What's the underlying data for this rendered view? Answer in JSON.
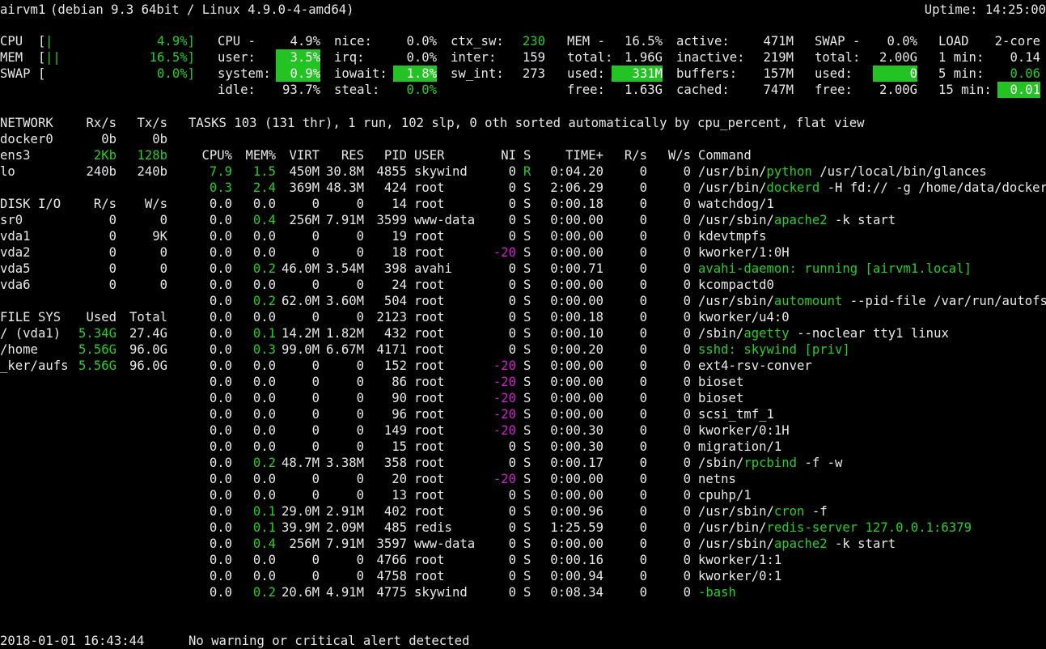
{
  "header": {
    "host": "airvm1",
    "os": "(debian 9.3 64bit / Linux 4.9.0-4-amd64)",
    "uptime": "Uptime: 14:25:00"
  },
  "quicklook": {
    "cpu_label": "CPU  [",
    "cpu_bar": "|",
    "cpu_value": "4.9%]",
    "mem_label": "MEM  [",
    "mem_bar": "||",
    "mem_value": "16.5%]",
    "swap_label": "SWAP [",
    "swap_value": "0.0%]"
  },
  "cpu": {
    "title": "CPU -",
    "total": "4.9%",
    "rows": [
      {
        "k": "user:",
        "v": "3.5%",
        "hl": true
      },
      {
        "k": "system:",
        "v": "0.9%",
        "hl": true
      },
      {
        "k": "idle:",
        "v": "93.7%",
        "hl": false
      }
    ],
    "col2": [
      {
        "k": "nice:",
        "v": "0.0%",
        "hl": false,
        "g": false
      },
      {
        "k": "irq:",
        "v": "0.0%",
        "hl": false,
        "g": false
      },
      {
        "k": "iowait:",
        "v": "1.8%",
        "hl": true,
        "g": false
      },
      {
        "k": "steal:",
        "v": "0.0%",
        "hl": false,
        "g": true
      }
    ],
    "col3": [
      {
        "k": "ctx_sw:",
        "v": "230",
        "g": true
      },
      {
        "k": "inter:",
        "v": "159",
        "g": false
      },
      {
        "k": "sw_int:",
        "v": "273",
        "g": false
      }
    ]
  },
  "mem": {
    "title": "MEM -",
    "total_pct": "16.5%",
    "rows": [
      {
        "k": "total:",
        "v": "1.96G",
        "hl": false
      },
      {
        "k": "used:",
        "v": "331M",
        "hl": true
      },
      {
        "k": "free:",
        "v": "1.63G",
        "hl": false
      }
    ],
    "col2": [
      {
        "k": "active:",
        "v": "471M"
      },
      {
        "k": "inactive:",
        "v": "219M"
      },
      {
        "k": "buffers:",
        "v": "157M"
      },
      {
        "k": "cached:",
        "v": "747M"
      }
    ]
  },
  "swap": {
    "title": "SWAP -",
    "total_pct": "0.0%",
    "rows": [
      {
        "k": "total:",
        "v": "2.00G",
        "hl": false
      },
      {
        "k": "used:",
        "v": "0",
        "hl": true
      },
      {
        "k": "free:",
        "v": "2.00G",
        "hl": false
      }
    ]
  },
  "load": {
    "title": "LOAD",
    "cores": "2-core",
    "rows": [
      {
        "k": "1 min:",
        "v": "0.14",
        "g": false,
        "hl": false
      },
      {
        "k": "5 min:",
        "v": "0.06",
        "g": true,
        "hl": false
      },
      {
        "k": "15 min:",
        "v": "0.01",
        "g": false,
        "hl": true
      }
    ]
  },
  "network": {
    "title": "NETWORK",
    "rx": "Rx/s",
    "tx": "Tx/s",
    "rows": [
      {
        "name": "docker0",
        "rx": "0b",
        "tx": "0b",
        "g": false
      },
      {
        "name": "ens3",
        "rx": "2Kb",
        "tx": "128b",
        "g": true
      },
      {
        "name": "lo",
        "rx": "240b",
        "tx": "240b",
        "g": false
      }
    ]
  },
  "diskio": {
    "title": "DISK I/O",
    "r": "R/s",
    "w": "W/s",
    "rows": [
      {
        "name": "sr0",
        "r": "0",
        "w": "0"
      },
      {
        "name": "vda1",
        "r": "0",
        "w": "9K"
      },
      {
        "name": "vda2",
        "r": "0",
        "w": "0"
      },
      {
        "name": "vda5",
        "r": "0",
        "w": "0"
      },
      {
        "name": "vda6",
        "r": "0",
        "w": "0"
      }
    ]
  },
  "fs": {
    "title": "FILE SYS",
    "used": "Used",
    "total": "Total",
    "rows": [
      {
        "name": "/ (vda1)",
        "used": "5.34G",
        "total": "27.4G"
      },
      {
        "name": "/home",
        "used": "5.56G",
        "total": "96.0G"
      },
      {
        "name": "_ker/aufs",
        "used": "5.56G",
        "total": "96.0G"
      }
    ]
  },
  "tasks": {
    "summary": "TASKS 103 (131 thr), 1 run, 102 slp, 0 oth sorted automatically by cpu_percent, flat view",
    "headers": [
      "CPU%",
      "MEM%",
      "VIRT",
      "RES",
      "PID",
      "USER",
      "NI",
      "S",
      "TIME+",
      "R/s",
      "W/s",
      "Command"
    ],
    "rows": [
      {
        "cpu": "7.9",
        "mem": "1.5",
        "virt": "450M",
        "res": "30.8M",
        "pid": "4855",
        "user": "skywind",
        "ni": "0",
        "s": "R",
        "time": "0:04.20",
        "r": "0",
        "w": "0",
        "cmd_pre": "/usr/bin/",
        "cmd_hl": "python",
        "cmd_post": " /usr/local/bin/glances",
        "cpu_g": true,
        "mem_g": true,
        "s_g": true,
        "ni_m": false,
        "cmd_all_g": false
      },
      {
        "cpu": "0.3",
        "mem": "2.4",
        "virt": "369M",
        "res": "48.3M",
        "pid": "424",
        "user": "root",
        "ni": "0",
        "s": "S",
        "time": "2:06.29",
        "r": "0",
        "w": "0",
        "cmd_pre": "/usr/bin/",
        "cmd_hl": "dockerd",
        "cmd_post": " -H fd:// -g /home/data/docker",
        "cpu_g": true,
        "mem_g": true,
        "s_g": false,
        "ni_m": false,
        "cmd_all_g": false
      },
      {
        "cpu": "0.0",
        "mem": "0.0",
        "virt": "0",
        "res": "0",
        "pid": "14",
        "user": "root",
        "ni": "0",
        "s": "S",
        "time": "0:00.18",
        "r": "0",
        "w": "0",
        "cmd_pre": "watchdog/1",
        "cmd_hl": "",
        "cmd_post": "",
        "cpu_g": false,
        "mem_g": false,
        "s_g": false,
        "ni_m": false,
        "cmd_all_g": false
      },
      {
        "cpu": "0.0",
        "mem": "0.4",
        "virt": "256M",
        "res": "7.91M",
        "pid": "3599",
        "user": "www-data",
        "ni": "0",
        "s": "S",
        "time": "0:00.00",
        "r": "0",
        "w": "0",
        "cmd_pre": "/usr/sbin/",
        "cmd_hl": "apache2",
        "cmd_post": " -k start",
        "cpu_g": false,
        "mem_g": true,
        "s_g": false,
        "ni_m": false,
        "cmd_all_g": false
      },
      {
        "cpu": "0.0",
        "mem": "0.0",
        "virt": "0",
        "res": "0",
        "pid": "19",
        "user": "root",
        "ni": "0",
        "s": "S",
        "time": "0:00.00",
        "r": "0",
        "w": "0",
        "cmd_pre": "kdevtmpfs",
        "cmd_hl": "",
        "cmd_post": "",
        "cpu_g": false,
        "mem_g": false,
        "s_g": false,
        "ni_m": false,
        "cmd_all_g": false
      },
      {
        "cpu": "0.0",
        "mem": "0.0",
        "virt": "0",
        "res": "0",
        "pid": "18",
        "user": "root",
        "ni": "-20",
        "s": "S",
        "time": "0:00.00",
        "r": "0",
        "w": "0",
        "cmd_pre": "kworker/1:0H",
        "cmd_hl": "",
        "cmd_post": "",
        "cpu_g": false,
        "mem_g": false,
        "s_g": false,
        "ni_m": true,
        "cmd_all_g": false
      },
      {
        "cpu": "0.0",
        "mem": "0.2",
        "virt": "46.0M",
        "res": "3.54M",
        "pid": "398",
        "user": "avahi",
        "ni": "0",
        "s": "S",
        "time": "0:00.71",
        "r": "0",
        "w": "0",
        "cmd_pre": "avahi-daemon: running [airvm1.local]",
        "cmd_hl": "",
        "cmd_post": "",
        "cpu_g": false,
        "mem_g": true,
        "s_g": false,
        "ni_m": false,
        "cmd_all_g": true
      },
      {
        "cpu": "0.0",
        "mem": "0.0",
        "virt": "0",
        "res": "0",
        "pid": "24",
        "user": "root",
        "ni": "0",
        "s": "S",
        "time": "0:00.00",
        "r": "0",
        "w": "0",
        "cmd_pre": "kcompactd0",
        "cmd_hl": "",
        "cmd_post": "",
        "cpu_g": false,
        "mem_g": false,
        "s_g": false,
        "ni_m": false,
        "cmd_all_g": false
      },
      {
        "cpu": "0.0",
        "mem": "0.2",
        "virt": "62.0M",
        "res": "3.60M",
        "pid": "504",
        "user": "root",
        "ni": "0",
        "s": "S",
        "time": "0:00.00",
        "r": "0",
        "w": "0",
        "cmd_pre": "/usr/sbin/",
        "cmd_hl": "automount",
        "cmd_post": " --pid-file /var/run/autofs.p",
        "cpu_g": false,
        "mem_g": true,
        "s_g": false,
        "ni_m": false,
        "cmd_all_g": false
      },
      {
        "cpu": "0.0",
        "mem": "0.0",
        "virt": "0",
        "res": "0",
        "pid": "2123",
        "user": "root",
        "ni": "0",
        "s": "S",
        "time": "0:00.18",
        "r": "0",
        "w": "0",
        "cmd_pre": "kworker/u4:0",
        "cmd_hl": "",
        "cmd_post": "",
        "cpu_g": false,
        "mem_g": false,
        "s_g": false,
        "ni_m": false,
        "cmd_all_g": false
      },
      {
        "cpu": "0.0",
        "mem": "0.1",
        "virt": "14.2M",
        "res": "1.82M",
        "pid": "432",
        "user": "root",
        "ni": "0",
        "s": "S",
        "time": "0:00.10",
        "r": "0",
        "w": "0",
        "cmd_pre": "/sbin/",
        "cmd_hl": "agetty",
        "cmd_post": " --noclear tty1 linux",
        "cpu_g": false,
        "mem_g": true,
        "s_g": false,
        "ni_m": false,
        "cmd_all_g": false
      },
      {
        "cpu": "0.0",
        "mem": "0.3",
        "virt": "99.0M",
        "res": "6.67M",
        "pid": "4171",
        "user": "root",
        "ni": "0",
        "s": "S",
        "time": "0:00.20",
        "r": "0",
        "w": "0",
        "cmd_pre": "sshd: skywind [priv]",
        "cmd_hl": "",
        "cmd_post": "",
        "cpu_g": false,
        "mem_g": true,
        "s_g": false,
        "ni_m": false,
        "cmd_all_g": true
      },
      {
        "cpu": "0.0",
        "mem": "0.0",
        "virt": "0",
        "res": "0",
        "pid": "152",
        "user": "root",
        "ni": "-20",
        "s": "S",
        "time": "0:00.00",
        "r": "0",
        "w": "0",
        "cmd_pre": "ext4-rsv-conver",
        "cmd_hl": "",
        "cmd_post": "",
        "cpu_g": false,
        "mem_g": false,
        "s_g": false,
        "ni_m": true,
        "cmd_all_g": false
      },
      {
        "cpu": "0.0",
        "mem": "0.0",
        "virt": "0",
        "res": "0",
        "pid": "86",
        "user": "root",
        "ni": "-20",
        "s": "S",
        "time": "0:00.00",
        "r": "0",
        "w": "0",
        "cmd_pre": "bioset",
        "cmd_hl": "",
        "cmd_post": "",
        "cpu_g": false,
        "mem_g": false,
        "s_g": false,
        "ni_m": true,
        "cmd_all_g": false
      },
      {
        "cpu": "0.0",
        "mem": "0.0",
        "virt": "0",
        "res": "0",
        "pid": "90",
        "user": "root",
        "ni": "-20",
        "s": "S",
        "time": "0:00.00",
        "r": "0",
        "w": "0",
        "cmd_pre": "bioset",
        "cmd_hl": "",
        "cmd_post": "",
        "cpu_g": false,
        "mem_g": false,
        "s_g": false,
        "ni_m": true,
        "cmd_all_g": false
      },
      {
        "cpu": "0.0",
        "mem": "0.0",
        "virt": "0",
        "res": "0",
        "pid": "96",
        "user": "root",
        "ni": "-20",
        "s": "S",
        "time": "0:00.00",
        "r": "0",
        "w": "0",
        "cmd_pre": "scsi_tmf_1",
        "cmd_hl": "",
        "cmd_post": "",
        "cpu_g": false,
        "mem_g": false,
        "s_g": false,
        "ni_m": true,
        "cmd_all_g": false
      },
      {
        "cpu": "0.0",
        "mem": "0.0",
        "virt": "0",
        "res": "0",
        "pid": "149",
        "user": "root",
        "ni": "-20",
        "s": "S",
        "time": "0:00.30",
        "r": "0",
        "w": "0",
        "cmd_pre": "kworker/0:1H",
        "cmd_hl": "",
        "cmd_post": "",
        "cpu_g": false,
        "mem_g": false,
        "s_g": false,
        "ni_m": true,
        "cmd_all_g": false
      },
      {
        "cpu": "0.0",
        "mem": "0.0",
        "virt": "0",
        "res": "0",
        "pid": "15",
        "user": "root",
        "ni": "0",
        "s": "S",
        "time": "0:00.30",
        "r": "0",
        "w": "0",
        "cmd_pre": "migration/1",
        "cmd_hl": "",
        "cmd_post": "",
        "cpu_g": false,
        "mem_g": false,
        "s_g": false,
        "ni_m": false,
        "cmd_all_g": false
      },
      {
        "cpu": "0.0",
        "mem": "0.2",
        "virt": "48.7M",
        "res": "3.38M",
        "pid": "358",
        "user": "root",
        "ni": "0",
        "s": "S",
        "time": "0:00.17",
        "r": "0",
        "w": "0",
        "cmd_pre": "/sbin/",
        "cmd_hl": "rpcbind",
        "cmd_post": " -f -w",
        "cpu_g": false,
        "mem_g": true,
        "s_g": false,
        "ni_m": false,
        "cmd_all_g": false
      },
      {
        "cpu": "0.0",
        "mem": "0.0",
        "virt": "0",
        "res": "0",
        "pid": "20",
        "user": "root",
        "ni": "-20",
        "s": "S",
        "time": "0:00.00",
        "r": "0",
        "w": "0",
        "cmd_pre": "netns",
        "cmd_hl": "",
        "cmd_post": "",
        "cpu_g": false,
        "mem_g": false,
        "s_g": false,
        "ni_m": true,
        "cmd_all_g": false
      },
      {
        "cpu": "0.0",
        "mem": "0.0",
        "virt": "0",
        "res": "0",
        "pid": "13",
        "user": "root",
        "ni": "0",
        "s": "S",
        "time": "0:00.00",
        "r": "0",
        "w": "0",
        "cmd_pre": "cpuhp/1",
        "cmd_hl": "",
        "cmd_post": "",
        "cpu_g": false,
        "mem_g": false,
        "s_g": false,
        "ni_m": false,
        "cmd_all_g": false
      },
      {
        "cpu": "0.0",
        "mem": "0.1",
        "virt": "29.0M",
        "res": "2.91M",
        "pid": "402",
        "user": "root",
        "ni": "0",
        "s": "S",
        "time": "0:00.96",
        "r": "0",
        "w": "0",
        "cmd_pre": "/usr/sbin/",
        "cmd_hl": "cron",
        "cmd_post": " -f",
        "cpu_g": false,
        "mem_g": true,
        "s_g": false,
        "ni_m": false,
        "cmd_all_g": false
      },
      {
        "cpu": "0.0",
        "mem": "0.1",
        "virt": "39.9M",
        "res": "2.09M",
        "pid": "485",
        "user": "redis",
        "ni": "0",
        "s": "S",
        "time": "1:25.59",
        "r": "0",
        "w": "0",
        "cmd_pre": "/usr/bin/",
        "cmd_hl": "redis-server 127.0.0.1:6379",
        "cmd_post": "",
        "cpu_g": false,
        "mem_g": true,
        "s_g": false,
        "ni_m": false,
        "cmd_all_g": false
      },
      {
        "cpu": "0.0",
        "mem": "0.4",
        "virt": "256M",
        "res": "7.91M",
        "pid": "3597",
        "user": "www-data",
        "ni": "0",
        "s": "S",
        "time": "0:00.00",
        "r": "0",
        "w": "0",
        "cmd_pre": "/usr/sbin/",
        "cmd_hl": "apache2",
        "cmd_post": " -k start",
        "cpu_g": false,
        "mem_g": true,
        "s_g": false,
        "ni_m": false,
        "cmd_all_g": false
      },
      {
        "cpu": "0.0",
        "mem": "0.0",
        "virt": "0",
        "res": "0",
        "pid": "4766",
        "user": "root",
        "ni": "0",
        "s": "S",
        "time": "0:00.16",
        "r": "0",
        "w": "0",
        "cmd_pre": "kworker/1:1",
        "cmd_hl": "",
        "cmd_post": "",
        "cpu_g": false,
        "mem_g": false,
        "s_g": false,
        "ni_m": false,
        "cmd_all_g": false
      },
      {
        "cpu": "0.0",
        "mem": "0.0",
        "virt": "0",
        "res": "0",
        "pid": "4758",
        "user": "root",
        "ni": "0",
        "s": "S",
        "time": "0:00.94",
        "r": "0",
        "w": "0",
        "cmd_pre": "kworker/0:1",
        "cmd_hl": "",
        "cmd_post": "",
        "cpu_g": false,
        "mem_g": false,
        "s_g": false,
        "ni_m": false,
        "cmd_all_g": false
      },
      {
        "cpu": "0.0",
        "mem": "0.2",
        "virt": "20.6M",
        "res": "4.91M",
        "pid": "4775",
        "user": "skywind",
        "ni": "0",
        "s": "S",
        "time": "0:08.34",
        "r": "0",
        "w": "0",
        "cmd_pre": "",
        "cmd_hl": "-bash",
        "cmd_post": "",
        "cpu_g": false,
        "mem_g": true,
        "s_g": false,
        "ni_m": false,
        "cmd_all_g": false
      }
    ]
  },
  "footer": {
    "datetime": "2018-01-01 16:43:44",
    "alert": "No warning or critical alert detected"
  },
  "colors": {
    "background": "#000000",
    "text": "#e8e8e8",
    "ok_green": "#22d022",
    "highlight_bg": "#22c322",
    "nice_magenta": "#d020d0"
  }
}
